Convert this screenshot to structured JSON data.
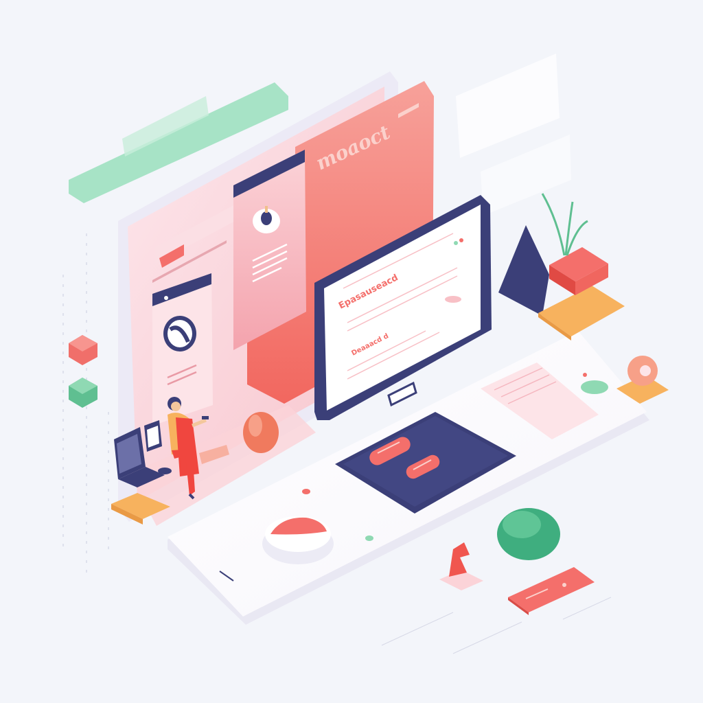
{
  "palette": {
    "background": "#f3f5fa",
    "coral": "#f46f6b",
    "pink": "#f8b5bd",
    "navy": "#3b3f78",
    "mint": "#8fd9b3",
    "orange": "#f7b25e",
    "white": "#ffffff"
  },
  "back_panel": {
    "heading": "moaoct"
  },
  "monitor": {
    "line_1": "Epasauseacd",
    "line_2": "Deaaacd d"
  },
  "icons": [
    "plant-icon",
    "avatar-icon",
    "person-icon",
    "laptop-icon",
    "cube-icon",
    "blob-icon"
  ]
}
